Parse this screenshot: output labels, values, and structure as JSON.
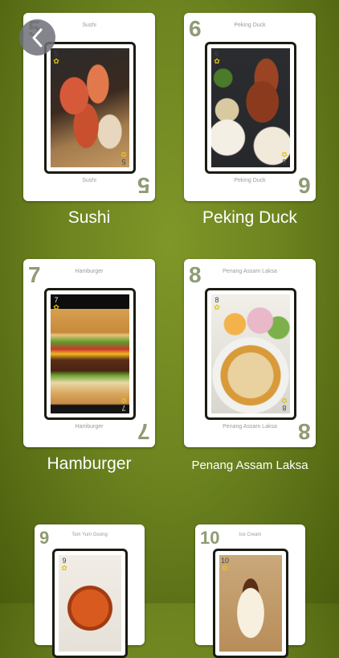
{
  "nav": {
    "back_icon": "chevron-left-icon"
  },
  "cards": [
    {
      "id": "sushi",
      "number": "5",
      "name": "Sushi",
      "label": "Sushi"
    },
    {
      "id": "peking-duck",
      "number": "6",
      "name": "Peking Duck",
      "label": "Peking Duck"
    },
    {
      "id": "hamburger",
      "number": "7",
      "name": "Hamburger",
      "label": "Hamburger"
    },
    {
      "id": "penang-assam-laksa",
      "number": "8",
      "name": "Penang Assam Laksa",
      "label": "Penang Assam Laksa"
    },
    {
      "id": "tom-yum-goong",
      "number": "9",
      "name": "Tom Yum Goong"
    },
    {
      "id": "ice-cream",
      "number": "10",
      "name": "Ice Cream"
    }
  ],
  "suit_symbol": "✿",
  "colors": {
    "background": "#6d8420",
    "corner_number": "#8f9b73"
  }
}
